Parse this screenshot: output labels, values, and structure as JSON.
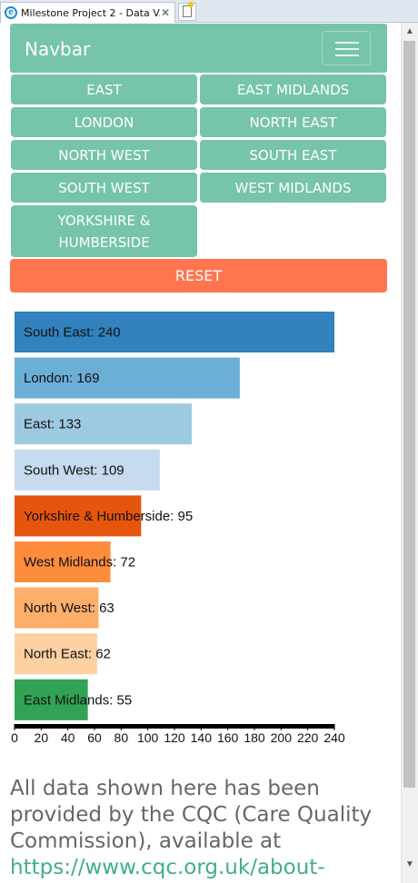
{
  "browser": {
    "tab_title": "Milestone Project 2 - Data V...",
    "tab_close": "✕"
  },
  "navbar": {
    "brand": "Navbar"
  },
  "regions": [
    "EAST",
    "EAST MIDLANDS",
    "LONDON",
    "NORTH EAST",
    "NORTH WEST",
    "SOUTH EAST",
    "SOUTH WEST",
    "WEST MIDLANDS",
    "YORKSHIRE & HUMBERSIDE"
  ],
  "reset_label": "RESET",
  "chart_data": {
    "type": "bar",
    "orientation": "horizontal",
    "categories": [
      "South East",
      "London",
      "East",
      "South West",
      "Yorkshire & Humberside",
      "West Midlands",
      "North West",
      "North East",
      "East Midlands"
    ],
    "values": [
      240,
      169,
      133,
      109,
      95,
      72,
      63,
      62,
      55
    ],
    "labels": [
      "South East: 240",
      "London: 169",
      "East: 133",
      "South West: 109",
      "Yorkshire & Humberside: 95",
      "West Midlands: 72",
      "North West: 63",
      "North East: 62",
      "East Midlands: 55"
    ],
    "colors": [
      "#3182bd",
      "#6baed6",
      "#9ecae1",
      "#c6dbef",
      "#e6550d",
      "#fd8d3c",
      "#fdae6b",
      "#fdd0a2",
      "#31a354"
    ],
    "xlim": [
      0,
      240
    ],
    "xticks": [
      0,
      20,
      40,
      60,
      80,
      100,
      120,
      140,
      160,
      180,
      200,
      220,
      240
    ]
  },
  "footer": {
    "text": "All data shown here has been provided by the CQC (Care Quality Commission), available at ",
    "link": "https://www.cqc.org.uk/about-"
  }
}
